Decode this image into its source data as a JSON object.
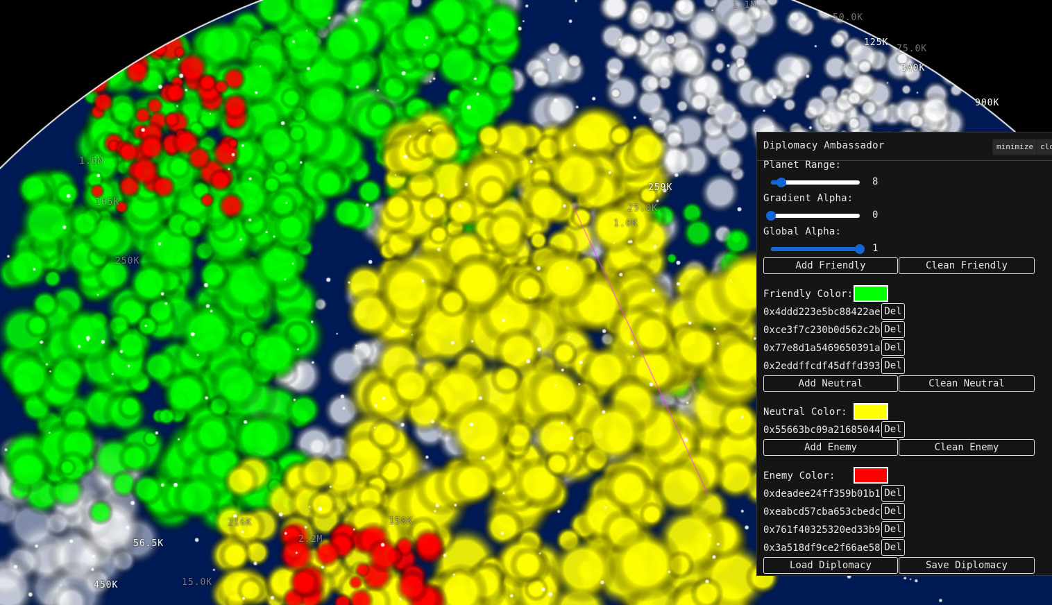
{
  "map": {
    "labels": [
      {
        "text": "125K"
      },
      {
        "text": "300K"
      },
      {
        "text": "900K"
      },
      {
        "text": "50.0K"
      },
      {
        "text": "75.0K"
      },
      {
        "text": "1.1M"
      },
      {
        "text": "1.6M"
      },
      {
        "text": "105K"
      },
      {
        "text": "250K"
      },
      {
        "text": "259K"
      },
      {
        "text": "2.2M"
      },
      {
        "text": "150K"
      },
      {
        "text": "56.5K"
      },
      {
        "text": "450K"
      },
      {
        "text": "216K"
      },
      {
        "text": "15.0K"
      },
      {
        "text": "25.0K"
      },
      {
        "text": "1.0K"
      }
    ],
    "colors": {
      "friendly": "#00ff00",
      "neutral": "#ffff00",
      "enemy": "#ff0000",
      "ocean": "#001a55",
      "link": "#ff33ff"
    }
  },
  "panel": {
    "title": "Diplomacy Ambassador",
    "minimize_label": "minimize",
    "close_label": "clo",
    "planet_range": {
      "label": "Planet Range:",
      "value": "8",
      "fraction": 0.12
    },
    "gradient_alpha": {
      "label": "Gradient Alpha:",
      "value": "0",
      "fraction": 0.0
    },
    "global_alpha": {
      "label": "Global Alpha:",
      "value": "1",
      "fraction": 1.0
    },
    "friendly": {
      "add_label": "Add Friendly",
      "clean_label": "Clean Friendly",
      "color_label": "Friendly Color:",
      "color": "#00ff00",
      "addresses": [
        "0x4ddd223e5bc88422ae",
        "0xce3f7c230b0d562c2b",
        "0x77e8d1a5469650391a",
        "0x2eddffcdf45dffd393"
      ]
    },
    "neutral": {
      "add_label": "Add Neutral",
      "clean_label": "Clean Neutral",
      "color_label": "Neutral Color:",
      "color": "#ffff00",
      "addresses": [
        "0x55663bc09a21685044"
      ]
    },
    "enemy": {
      "add_label": "Add Enemy",
      "clean_label": "Clean Enemy",
      "color_label": "Enemy Color:",
      "color": "#ff0000",
      "addresses": [
        "0xdeadee24ff359b01b1",
        "0xeabcd57cba653cbedc",
        "0x761f40325320ed33b9",
        "0x3a518df9ce2f66ae58"
      ]
    },
    "del_label": "Del",
    "load_label": "Load Diplomacy",
    "save_label": "Save Diplomacy"
  }
}
